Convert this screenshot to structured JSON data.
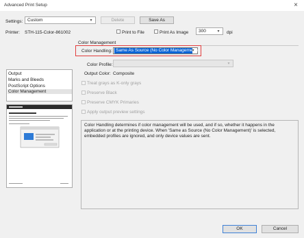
{
  "window": {
    "title": "Advanced Print Setup",
    "close_glyph": "×"
  },
  "settings": {
    "label": "Settings:",
    "value": "Custom",
    "delete_label": "Delete",
    "save_as_label": "Save As"
  },
  "printer": {
    "label": "Printer:",
    "name": "STH-115-Color-861002"
  },
  "options": {
    "print_to_file": "Print to File",
    "print_as_image": "Print As Image",
    "dpi_value": "300",
    "dpi_unit": "dpi"
  },
  "sidebar": {
    "items": [
      {
        "label": "Output"
      },
      {
        "label": "Marks and Bleeds"
      },
      {
        "label": "PostScript Options"
      },
      {
        "label": "Color Management"
      }
    ]
  },
  "color_management": {
    "group_title": "Color Management",
    "color_handling_label": "Color Handling:",
    "color_handling_value": "Same As Source (No Color Management)",
    "color_profile_label": "Color Profile:",
    "color_profile_value": "",
    "output_color_label": "Output Color:",
    "output_color_value": "Composite",
    "treat_grays": "Treat grays as K-only grays",
    "preserve_black": "Preserve Black",
    "preserve_cmyk": "Preserve CMYK Primaries",
    "apply_preview": "Apply output preview settings",
    "description": "Color Handling determines if color management will be used, and if so, whether it happens in the application or at the printing device. When 'Same as Source (No Color Management)' is selected, embedded profiles are ignored, and only device values are sent."
  },
  "footer": {
    "ok_label": "OK",
    "cancel_label": "Cancel"
  },
  "colors": {
    "highlight_border": "#e23c3c",
    "selected_bg": "#0a64d6"
  }
}
